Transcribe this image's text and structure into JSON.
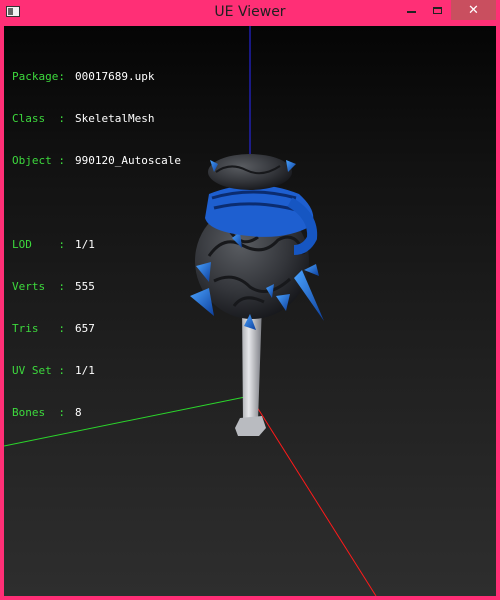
{
  "window": {
    "title": "UE Viewer",
    "controls": {
      "close": "✕"
    }
  },
  "info": {
    "package_label": "Package:",
    "package_value": "00017689.upk",
    "class_label": "Class  :",
    "class_value": "SkeletalMesh",
    "object_label": "Object :",
    "object_value": "990120_Autoscale",
    "lod_label": "LOD    :",
    "lod_value": "1/1",
    "verts_label": "Verts  :",
    "verts_value": "555",
    "tris_label": "Tris   :",
    "tris_value": "657",
    "uvset_label": "UV Set :",
    "uvset_value": "1/1",
    "bones_label": "Bones  :",
    "bones_value": "8"
  },
  "colors": {
    "frame": "#ff2f76",
    "axis_x": "#ff1a1a",
    "axis_y": "#2bd62b",
    "axis_z": "#2a2aff",
    "label": "#3dd93d",
    "mesh_blue": "#1d6fe0",
    "mesh_stone": "#3b3d40"
  }
}
